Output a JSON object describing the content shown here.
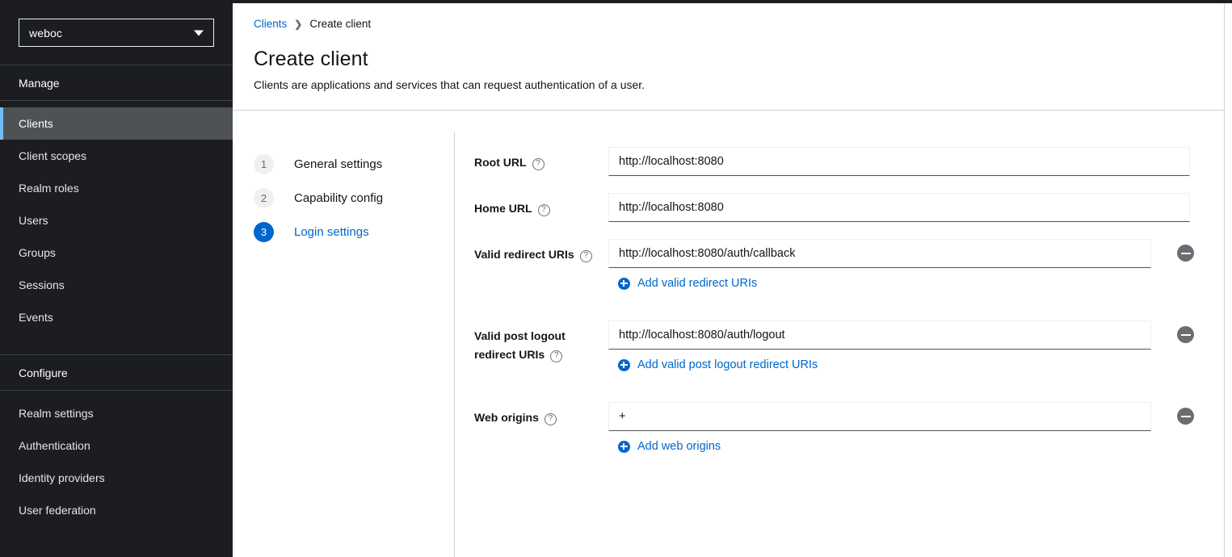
{
  "sidebar": {
    "realm_selector": {
      "value": "weboc",
      "icon": "chevron-down-icon"
    },
    "sections": [
      {
        "title": "Manage",
        "items": [
          {
            "label": "Clients",
            "active": true
          },
          {
            "label": "Client scopes",
            "active": false
          },
          {
            "label": "Realm roles",
            "active": false
          },
          {
            "label": "Users",
            "active": false
          },
          {
            "label": "Groups",
            "active": false
          },
          {
            "label": "Sessions",
            "active": false
          },
          {
            "label": "Events",
            "active": false
          }
        ]
      },
      {
        "title": "Configure",
        "items": [
          {
            "label": "Realm settings",
            "active": false
          },
          {
            "label": "Authentication",
            "active": false
          },
          {
            "label": "Identity providers",
            "active": false
          },
          {
            "label": "User federation",
            "active": false
          }
        ]
      }
    ]
  },
  "header": {
    "breadcrumb": {
      "parent": "Clients",
      "separator": "❯",
      "current": "Create client"
    },
    "title": "Create client",
    "subtitle": "Clients are applications and services that can request authentication of a user."
  },
  "wizard": {
    "steps": [
      {
        "num": "1",
        "label": "General settings",
        "current": false
      },
      {
        "num": "2",
        "label": "Capability config",
        "current": false
      },
      {
        "num": "3",
        "label": "Login settings",
        "current": true
      }
    ]
  },
  "form": {
    "help_glyph": "?",
    "fields": {
      "root_url": {
        "label": "Root URL",
        "value": "http://localhost:8080"
      },
      "home_url": {
        "label": "Home URL",
        "value": "http://localhost:8080"
      },
      "redirect": {
        "label": "Valid redirect URIs",
        "value": "http://localhost:8080/auth/callback",
        "add_label": "Add valid redirect URIs"
      },
      "post_logout": {
        "label_line1": "Valid post logout",
        "label_line2": "redirect URIs",
        "value": "http://localhost:8080/auth/logout",
        "add_label": "Add valid post logout redirect URIs"
      },
      "web_origins": {
        "label": "Web origins",
        "value": "+",
        "add_label": "Add web origins"
      }
    }
  },
  "colors": {
    "sidebar_bg": "#1b1d21",
    "sidebar_active_bg": "#4f5255",
    "accent_blue": "#73bcf7",
    "link_blue": "#06c",
    "remove_gray": "#6a6e73"
  }
}
